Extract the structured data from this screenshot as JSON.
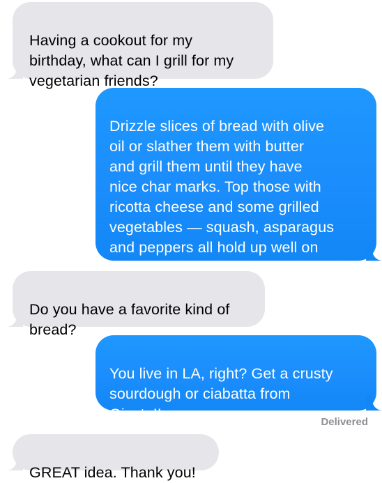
{
  "conversation": {
    "messages": [
      {
        "direction": "incoming",
        "text": "Having a cookout for my\nbirthday, what can I grill for my\nvegetarian friends?"
      },
      {
        "direction": "outgoing",
        "text": "Drizzle slices of bread with olive\noil or slather them with butter\nand grill them until they have\nnice char marks. Top those with\nricotta cheese and some grilled\nvegetables — squash, asparagus\nand peppers all hold up well on\nthe grill!"
      },
      {
        "direction": "incoming",
        "text": "Do you have a favorite kind of\nbread?"
      },
      {
        "direction": "outgoing",
        "text": "You live in LA, right? Get a crusty\nsourdough or ciabatta from\nGjusta!!"
      },
      {
        "direction": "incoming",
        "text": "GREAT idea. Thank you!"
      }
    ],
    "delivery_status": "Delivered"
  },
  "colors": {
    "incoming_bubble": "#e5e5ea",
    "outgoing_bubble": "#1b8dfc",
    "status_text": "#8e8e93"
  }
}
